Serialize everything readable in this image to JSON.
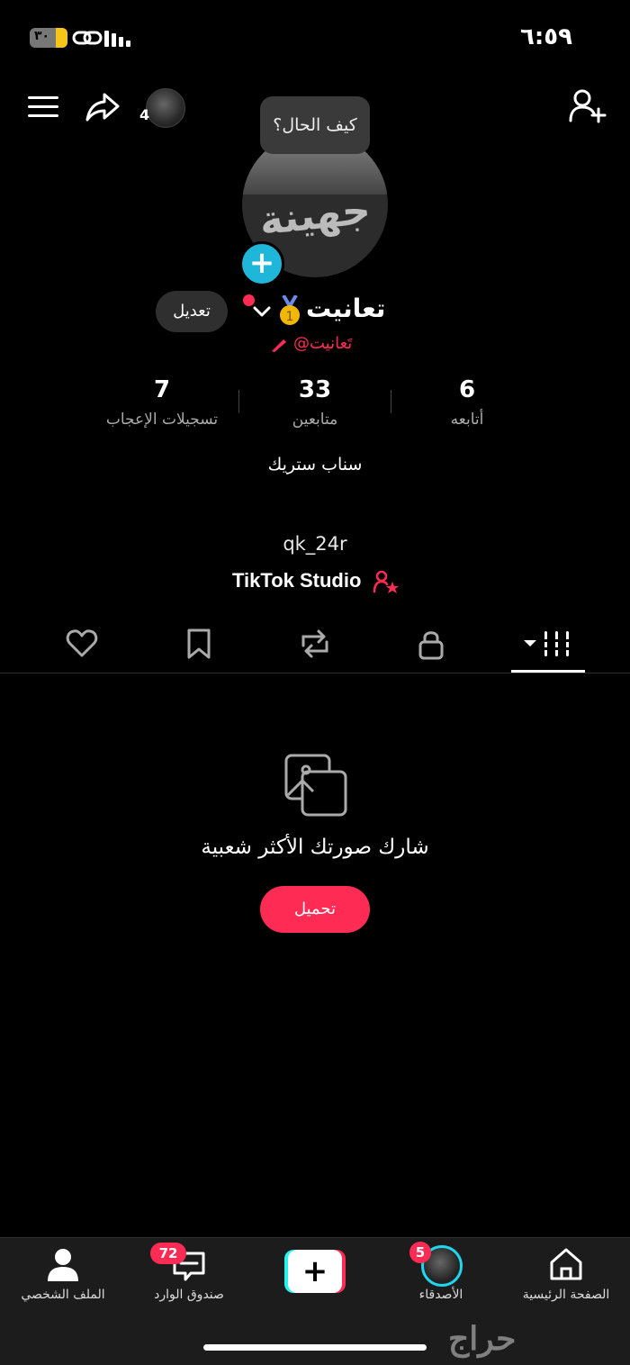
{
  "status_bar": {
    "time": "٦:٥٩",
    "battery": "٣٠"
  },
  "top_bar": {
    "story_count": "4"
  },
  "profile": {
    "bubble_text": "كيف الحال؟",
    "avatar_text": "جهينة",
    "edit_label": "تعديل",
    "display_name": "تعانيت",
    "handle": "@تَعانيت",
    "stats": [
      {
        "value": "7",
        "label": "تسجيلات الإعجاب"
      },
      {
        "value": "33",
        "label": "متابعين"
      },
      {
        "value": "6",
        "label": "أتابعه"
      }
    ],
    "bio": "سناب ستريك",
    "link": "qk_24r",
    "studio": "TikTok Studio"
  },
  "tabs": [
    {
      "name": "liked-tab",
      "icon": "heart-icon"
    },
    {
      "name": "saved-tab",
      "icon": "bookmark-icon"
    },
    {
      "name": "reposts-tab",
      "icon": "repost-icon"
    },
    {
      "name": "private-tab",
      "icon": "lock-icon"
    },
    {
      "name": "videos-tab",
      "icon": "grid-icon",
      "active": true
    }
  ],
  "empty_state": {
    "text": "شارك صورتك الأكثر شعبية",
    "button": "تحميل"
  },
  "bottom_nav": {
    "profile": "الملف الشخصي",
    "inbox": "صندوق الوارد",
    "inbox_badge": "72",
    "friends": "الأصدقاء",
    "friends_badge": "5",
    "home": "الصفحة الرئيسية"
  },
  "watermark": "حراج",
  "colors": {
    "accent": "#fe2c55",
    "cyan": "#25f4ee",
    "background": "#000000"
  }
}
